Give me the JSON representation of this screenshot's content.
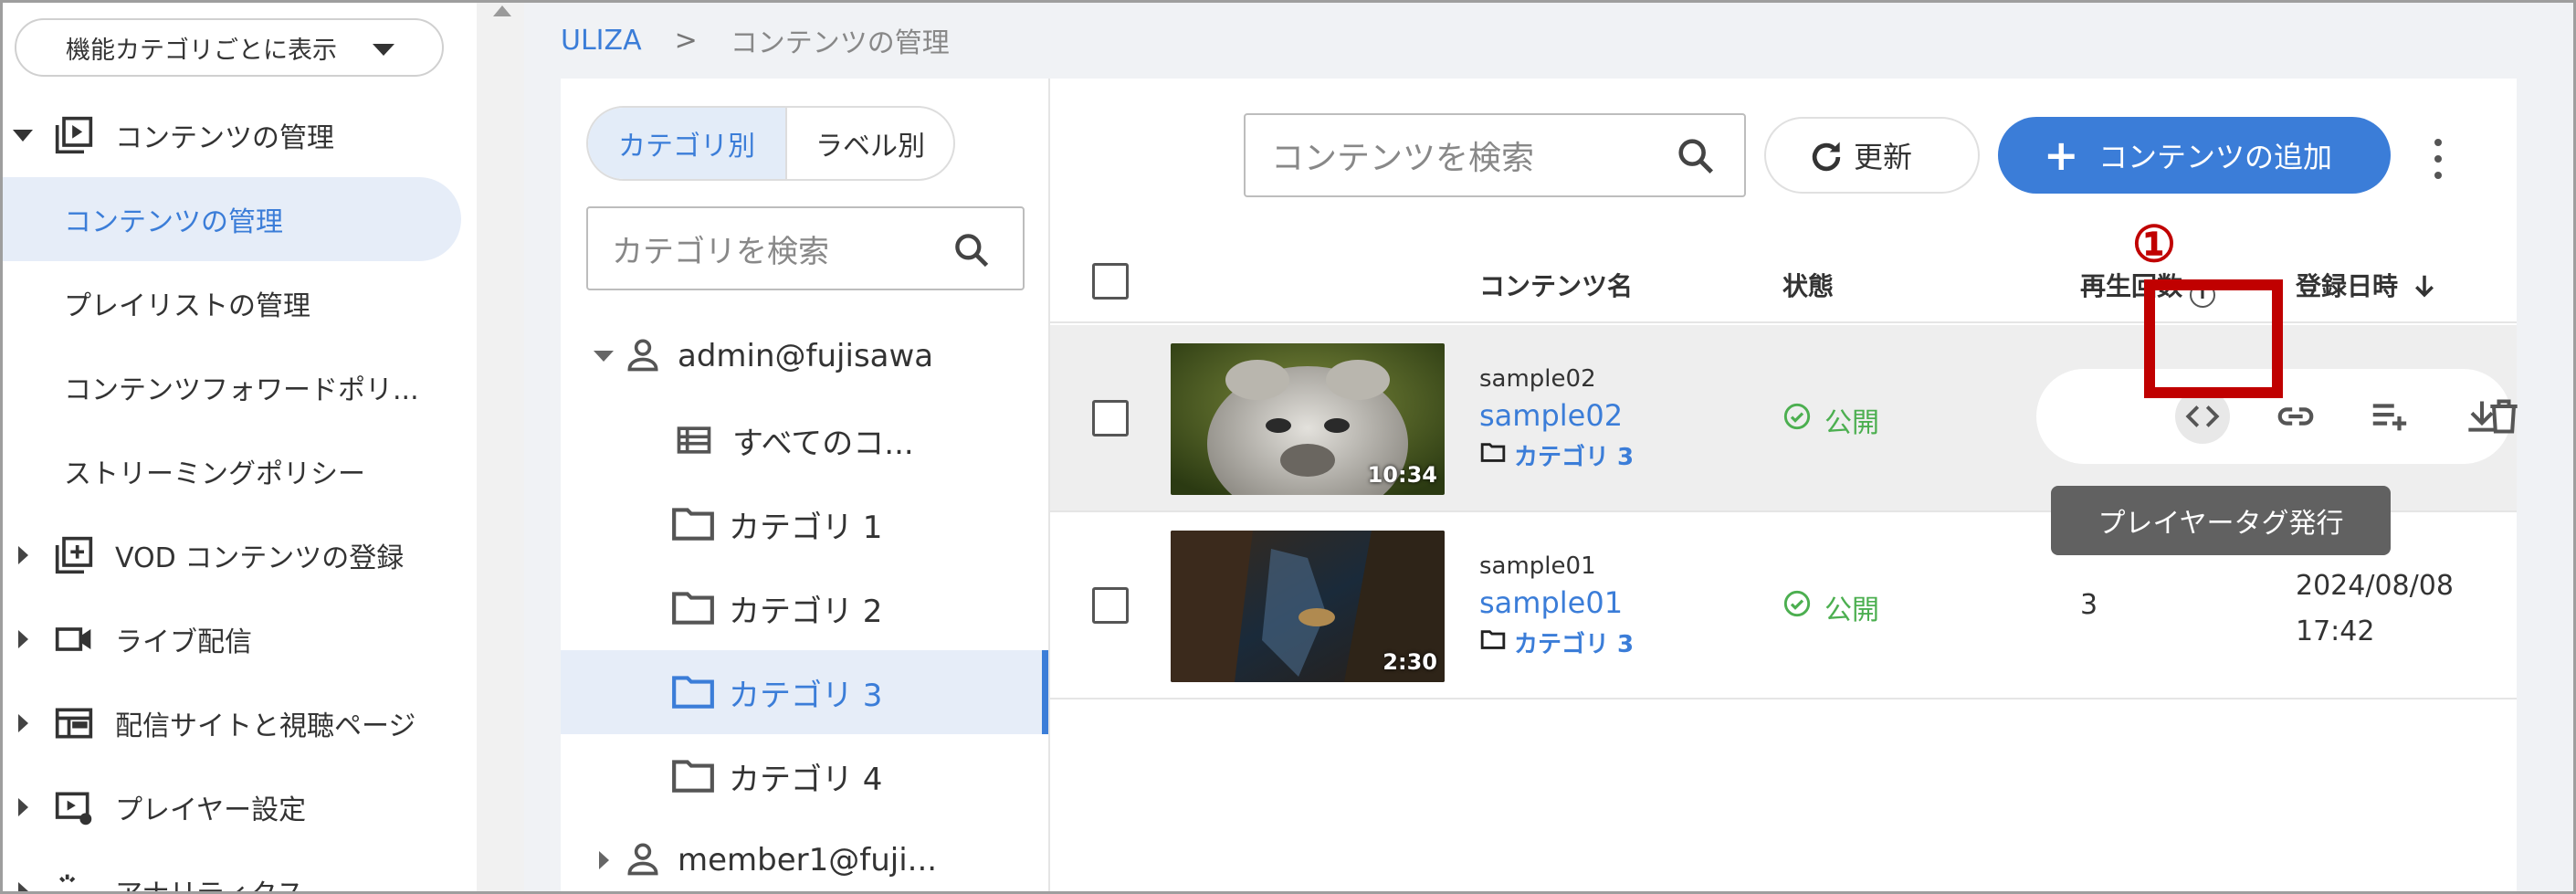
{
  "sidebar": {
    "view_select": "機能カテゴリごとに表示",
    "groups": [
      {
        "label": "コンテンツの管理",
        "icon": "video-library-icon"
      },
      {
        "label": "VOD コンテンツの登録",
        "icon": "add-box-icon"
      },
      {
        "label": "ライブ配信",
        "icon": "videocam-icon"
      },
      {
        "label": "配信サイトと視聴ページ",
        "icon": "web-layout-icon"
      },
      {
        "label": "プレイヤー設定",
        "icon": "player-settings-icon"
      },
      {
        "label": "アナリティクス",
        "icon": "analytics-icon"
      }
    ],
    "sub_items": [
      "コンテンツの管理",
      "プレイリストの管理",
      "コンテンツフォワードポリ...",
      "ストリーミングポリシー"
    ]
  },
  "breadcrumb": {
    "root": "ULIZA",
    "separator": ">",
    "current": "コンテンツの管理"
  },
  "category_panel": {
    "tabs": [
      "カテゴリ別",
      "ラベル別"
    ],
    "search_placeholder": "カテゴリを検索",
    "tree": {
      "owner": "admin@fujisawa",
      "all": "すべてのコ...",
      "categories": [
        "カテゴリ 1",
        "カテゴリ 2",
        "カテゴリ 3",
        "カテゴリ 4"
      ],
      "member": "member1@fuji..."
    }
  },
  "content_panel": {
    "search_placeholder": "コンテンツを検索",
    "refresh_label": "更新",
    "add_label": "コンテンツの追加",
    "columns": {
      "name": "コンテンツ名",
      "status": "状態",
      "plays": "再生回数",
      "date": "登録日時"
    },
    "rows": [
      {
        "id": "sample02",
        "name": "sample02",
        "category": "カテゴリ 3",
        "status": "公開",
        "duration": "10:34",
        "plays": "",
        "date": "",
        "time": ""
      },
      {
        "id": "sample01",
        "name": "sample01",
        "category": "カテゴリ 3",
        "status": "公開",
        "duration": "2:30",
        "plays": "3",
        "date": "2024/08/08",
        "time": "17:42"
      }
    ],
    "tooltip": "プレイヤータグ発行",
    "callout": "①"
  },
  "colors": {
    "accent": "#3b7dd8",
    "highlight": "#c00000",
    "published": "#4caf50"
  }
}
